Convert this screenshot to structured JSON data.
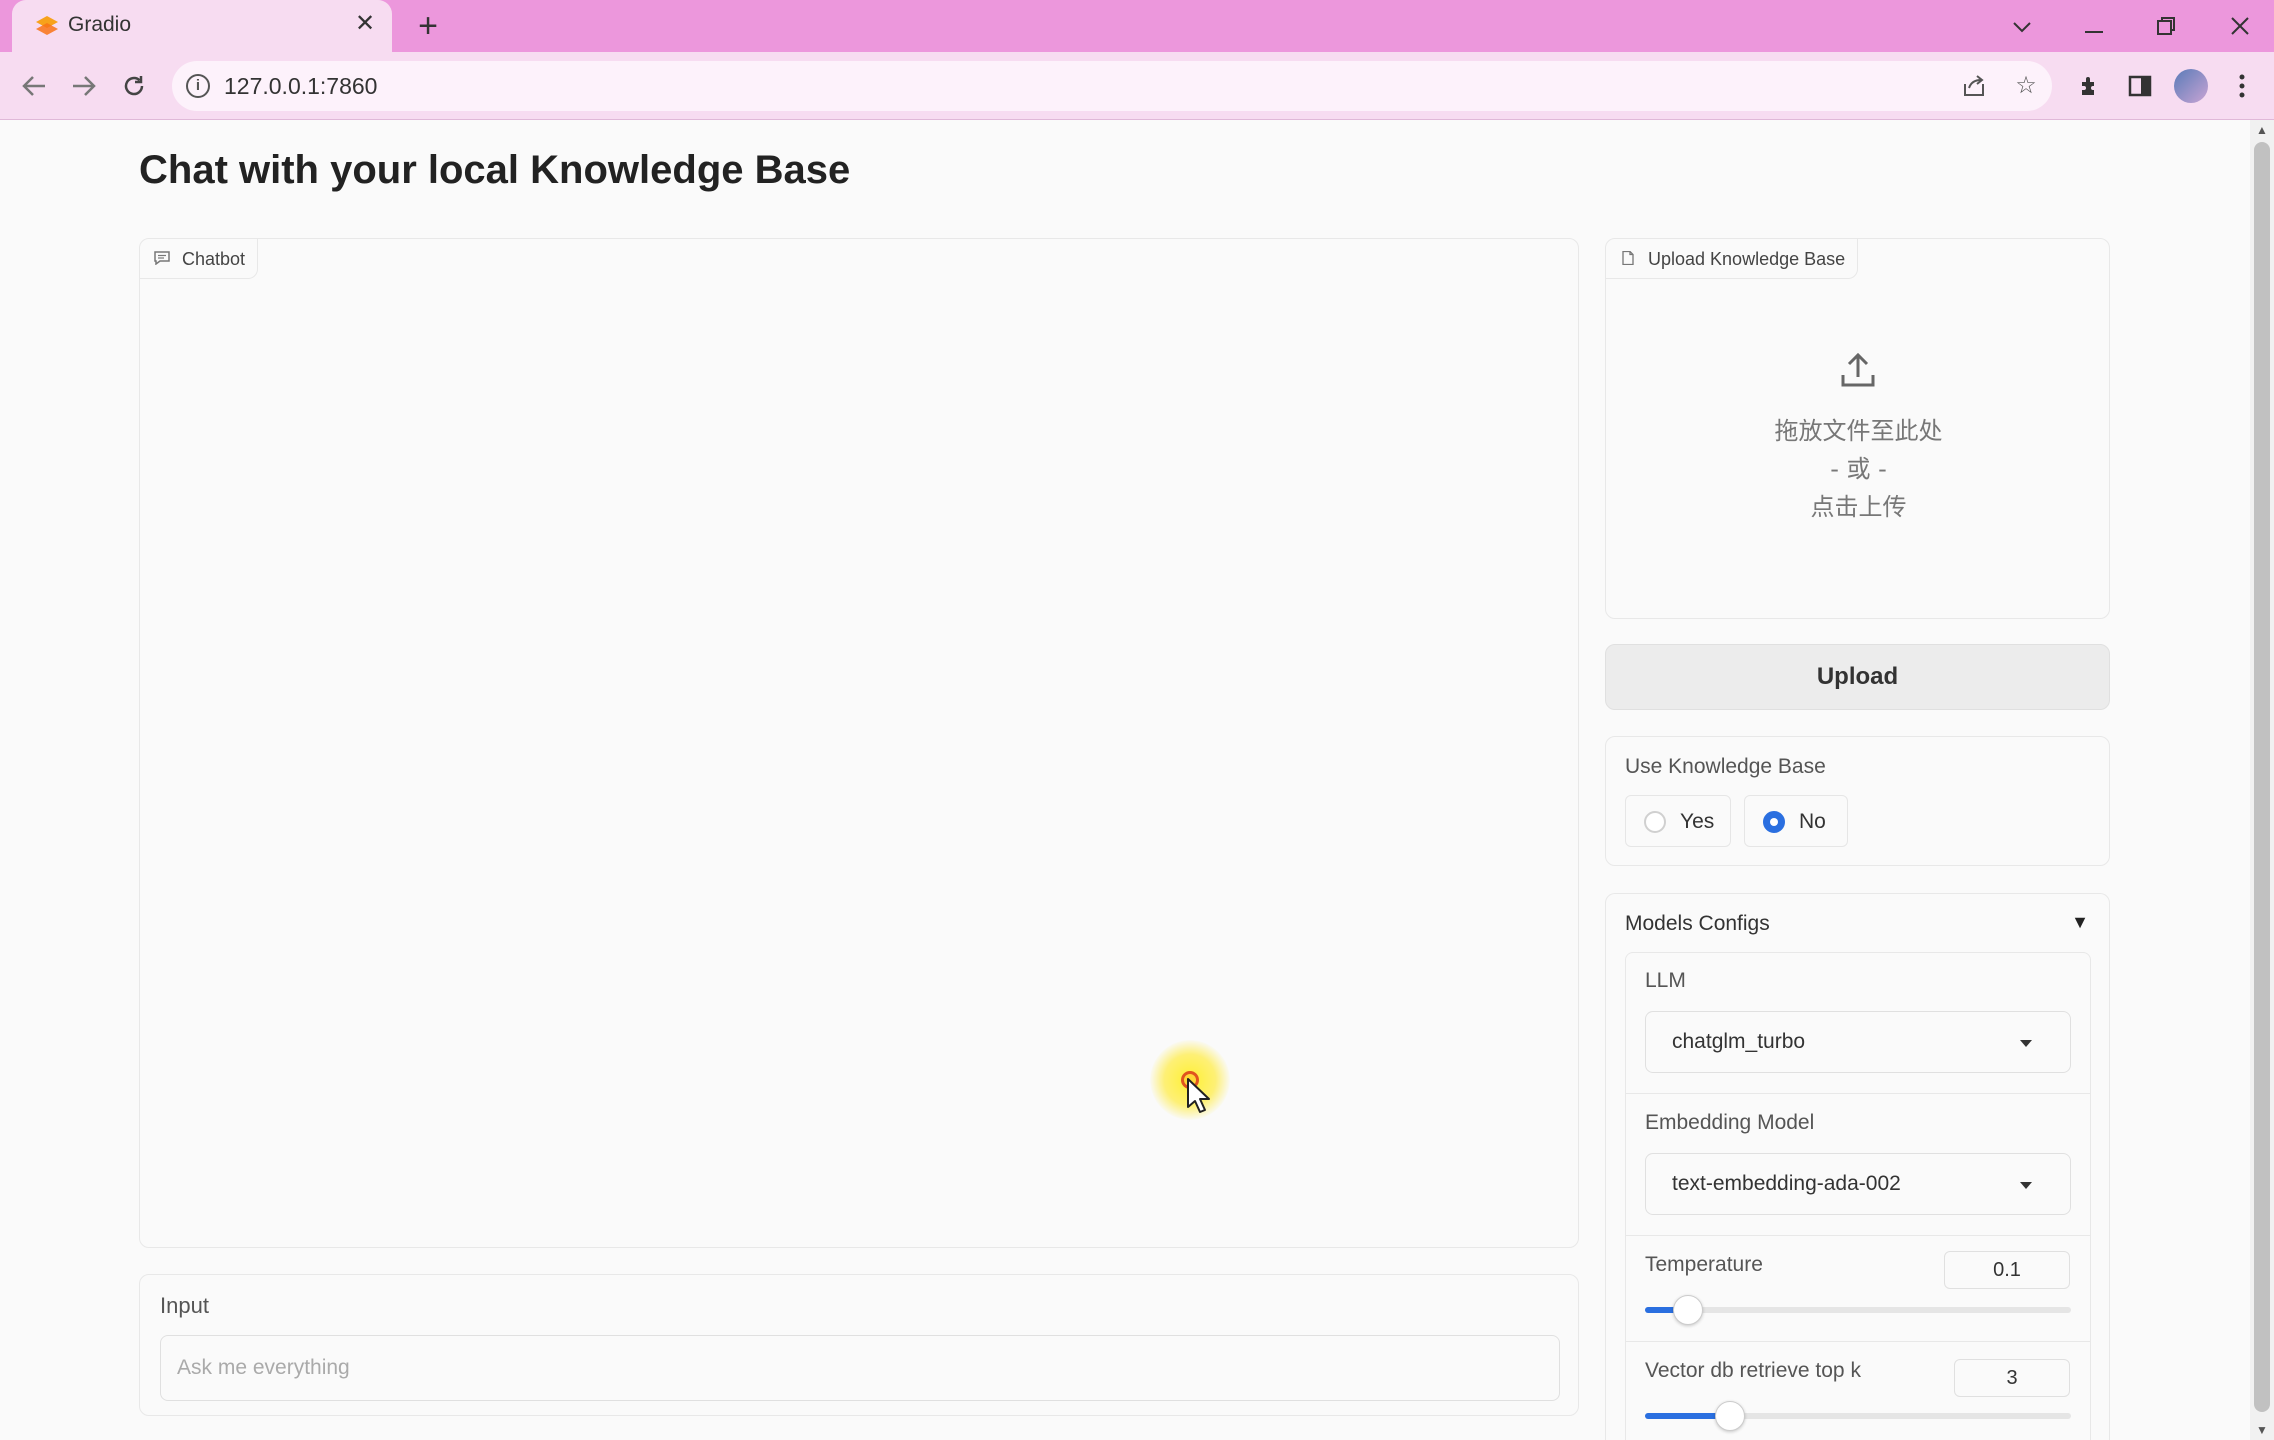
{
  "browser": {
    "tab_title": "Gradio",
    "tab_close": "✕",
    "new_tab": "+",
    "url": "127.0.0.1:7860",
    "colors": {
      "frame": "#ec97dc",
      "toolbar": "#f7dcf1"
    }
  },
  "page": {
    "title": "Chat with your local Knowledge Base"
  },
  "chatbot": {
    "label": "Chatbot"
  },
  "input": {
    "label": "Input",
    "placeholder": "Ask me everything",
    "value": ""
  },
  "upload": {
    "label": "Upload Knowledge Base",
    "drop_text": "拖放文件至此处",
    "or_text": "- 或 -",
    "click_text": "点击上传",
    "button_label": "Upload"
  },
  "knowledge_base": {
    "label": "Use Knowledge Base",
    "options": [
      "Yes",
      "No"
    ],
    "selected": "No"
  },
  "models_configs": {
    "title": "Models Configs",
    "llm": {
      "label": "LLM",
      "value": "chatglm_turbo"
    },
    "embedding": {
      "label": "Embedding Model",
      "value": "text-embedding-ada-002"
    },
    "temperature": {
      "label": "Temperature",
      "value": "0.1",
      "fraction": 0.1
    },
    "top_k": {
      "label": "Vector db retrieve top k",
      "value": "3",
      "fraction": 0.2
    }
  },
  "accent_color": "#2a6fe0"
}
